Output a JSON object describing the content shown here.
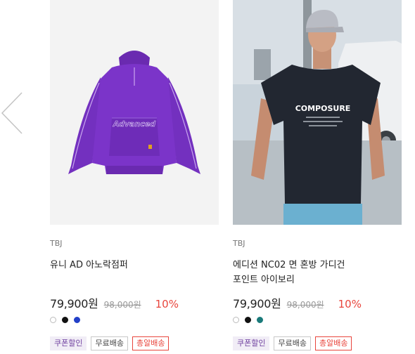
{
  "carousel": {
    "prev_icon": "chevron-left-icon"
  },
  "products": [
    {
      "image": "purple-anorak-jacket",
      "image_print": "Advanced",
      "brand": "TBJ",
      "title_line1": "유니 AD 아노락점퍼",
      "title_line2": "",
      "price": "79,900원",
      "original_price": "98,000원",
      "discount": "10%",
      "colors": [
        "#ffffff",
        "#111111",
        "#2340c8"
      ],
      "badges": {
        "coupon": "쿠폰할인",
        "free_shipping": "무료배송",
        "gun": "총알배송"
      }
    },
    {
      "image": "model-navy-tshirt",
      "image_print": "COMPOSURE",
      "brand": "TBJ",
      "title_line1": "에디션 NC02 면 혼방 가디건",
      "title_line2": "포인트 아이보리",
      "price": "79,900원",
      "original_price": "98,000원",
      "discount": "10%",
      "colors": [
        "#ffffff",
        "#111111",
        "#1a7a7a"
      ],
      "badges": {
        "coupon": "쿠폰할인",
        "free_shipping": "무료배송",
        "gun": "총알배송"
      }
    }
  ]
}
